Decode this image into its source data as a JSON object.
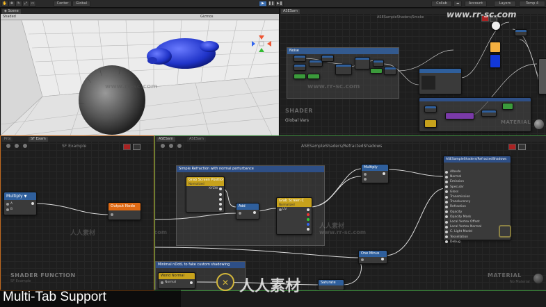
{
  "toolbar": {
    "pivot_label": "Center",
    "space_label": "Global",
    "collab_label": "Collab",
    "account_label": "Account",
    "layers_label": "Layers",
    "layout_label": "Temp 4"
  },
  "scene_panel": {
    "tab_label": "Scene",
    "shading_label": "Shaded",
    "gizmos_label": "Gizmos"
  },
  "top_right_panel": {
    "tab_label": "ASESam",
    "path_label": "ASESampleShaders/Smoke",
    "group_noise": "Noise",
    "corner_title": "SHADER",
    "corner_sub": "Global Vars",
    "material_title": "MATERIAL"
  },
  "left_panel": {
    "tab1": "Proj",
    "tab2": "SF Exam",
    "title": "SF Example",
    "multiply_node": "Multiply",
    "port_a": "A",
    "port_b": "B",
    "output_node": "Output Node",
    "corner_title": "SHADER FUNCTION",
    "corner_sub": "SF Example"
  },
  "main_panel": {
    "tab1": "ASESam",
    "tab2": "ASESam",
    "path_label": "ASESampleShaders/RefractedShadows",
    "group1": "Simple Refraction with normal perturbance",
    "grab_pos_node": "Grab Screen Position",
    "grab_pos_sub": "Normalized",
    "add_node": "Add",
    "grab_color_node": "Grab Screen C",
    "grab_color_sub": "Normalized",
    "uv_label": "UV",
    "multiply_node": "Multiply",
    "one_minus_node": "One Minus",
    "saturate_node": "Saturate",
    "group2": "Minimal nDotL to fake custom shadowing",
    "world_normal_node": "World Normal",
    "normal_label": "Normal",
    "output_title": "ASESampleShaders/RefractedShadows",
    "output_ports": [
      "Albedo",
      "Normal",
      "Emission",
      "Specular",
      "Gloss",
      "Transmission",
      "Translucency",
      "Refraction",
      "Opacity",
      "Opacity Mask",
      "Local Vertex Offset",
      "Local Vertex Normal",
      "C. Light Model",
      "Tessellation",
      "Debug"
    ],
    "material_title": "MATERIAL",
    "material_sub": "No Material"
  },
  "caption": "Multi-Tab Support",
  "watermark_url": "www.rr-sc.com",
  "watermark_cn": "人人素材",
  "colors": {
    "accent_blue": "#2e4f86",
    "node_yellow": "#c7a21c",
    "node_orange": "#e06a14",
    "node_blue": "#2f5f9c"
  }
}
